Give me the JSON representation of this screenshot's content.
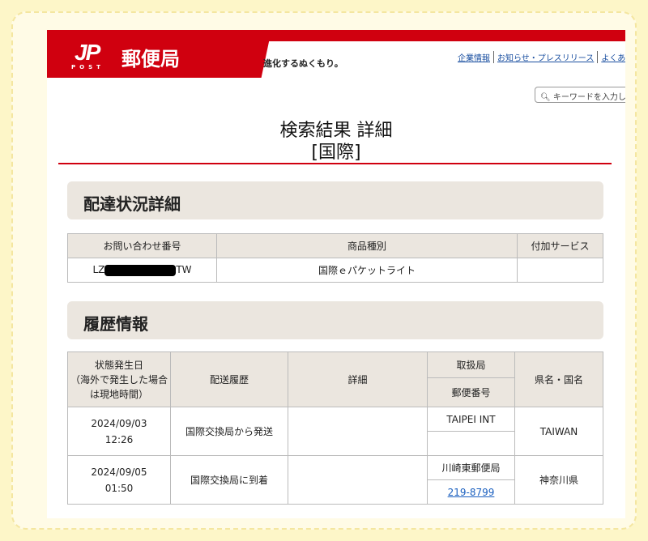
{
  "header": {
    "logo_mark": "JP",
    "logo_post": "POST",
    "logo_name": "郵便局",
    "tagline": "進化するぬくもり。",
    "links": [
      "企業情報",
      "お知らせ・プレスリリース",
      "よくあ"
    ],
    "search_placeholder": "キーワードを入力し"
  },
  "page": {
    "title_line1": "検索結果 詳細",
    "title_line2": "[国際]"
  },
  "delivery": {
    "heading": "配達状況詳細",
    "columns": [
      "お問い合わせ番号",
      "商品種別",
      "付加サービス"
    ],
    "tracking_prefix": "LZ",
    "tracking_suffix": "TW",
    "product": "国際ｅパケットライト",
    "service": ""
  },
  "history": {
    "heading": "履歴情報",
    "columns": {
      "date": "状態発生日\n（海外で発生した場合は現地時間）",
      "status": "配送履歴",
      "detail": "詳細",
      "office": "取扱局",
      "postal": "郵便番号",
      "region": "県名・国名"
    },
    "rows": [
      {
        "date": "2024/09/03",
        "time": "12:26",
        "status": "国際交換局から発送",
        "detail": "",
        "office": "TAIPEI INT",
        "postal": "",
        "region": "TAIWAN"
      },
      {
        "date": "2024/09/05",
        "time": "01:50",
        "status": "国際交換局に到着",
        "detail": "",
        "office": "川崎東郵便局",
        "postal": "219-8799",
        "region": "神奈川県"
      }
    ]
  },
  "colors": {
    "brand_red": "#d0000f",
    "section_bg": "#ebe6df",
    "frame": "#fdf6c8"
  }
}
